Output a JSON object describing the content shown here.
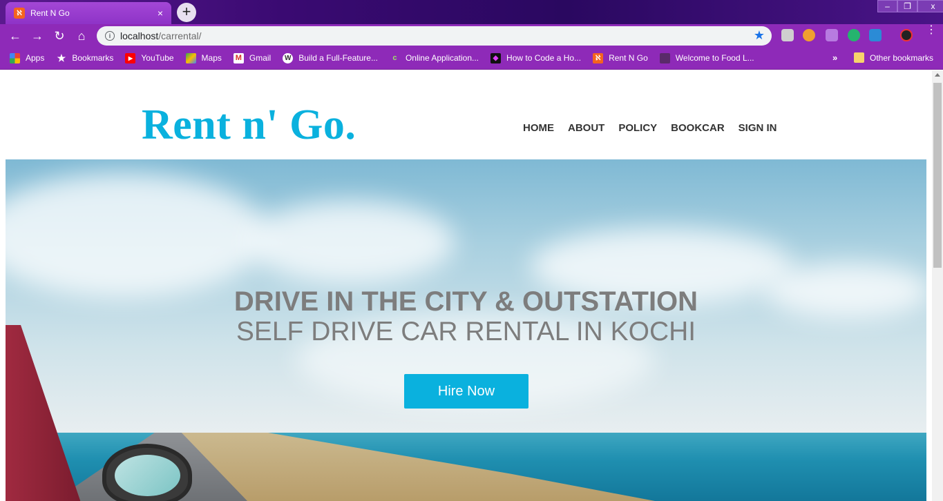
{
  "browser": {
    "tab": {
      "title": "Rent N Go",
      "favicon": "xampp-icon",
      "close": "×"
    },
    "new_tab": "+",
    "window_controls": {
      "minimize": "–",
      "restore": "❐",
      "close": "x"
    },
    "omnibox": {
      "host": "localhost",
      "path": "/carrental/"
    },
    "bookmarks": [
      {
        "label": "Apps",
        "icon": "apps-grid-icon"
      },
      {
        "label": "Bookmarks",
        "icon": "star-icon"
      },
      {
        "label": "YouTube",
        "icon": "youtube-icon"
      },
      {
        "label": "Maps",
        "icon": "maps-icon"
      },
      {
        "label": "Gmail",
        "icon": "gmail-icon"
      },
      {
        "label": "Build a Full-Feature...",
        "icon": "wordpress-icon"
      },
      {
        "label": "Online Application...",
        "icon": "c-icon"
      },
      {
        "label": "How to Code a Ho...",
        "icon": "code-icon"
      },
      {
        "label": "Rent N Go",
        "icon": "xampp-icon"
      },
      {
        "label": "Welcome to Food L...",
        "icon": "food-icon"
      }
    ],
    "more_bookmarks": "»",
    "other_bookmarks": "Other bookmarks"
  },
  "site": {
    "logo": "Rent n' Go.",
    "nav": [
      "HOME",
      "ABOUT",
      "POLICY",
      "BOOKCAR",
      "SIGN IN"
    ],
    "hero": {
      "line1": "DRIVE IN THE CITY & OUTSTATION",
      "line2": "SELF DRIVE CAR RENTAL IN KOCHI",
      "cta": "Hire Now"
    }
  },
  "colors": {
    "brand": "#0ab1de",
    "chrome_purple": "#8e2ab8",
    "hero_text": "#7d7d7d"
  }
}
